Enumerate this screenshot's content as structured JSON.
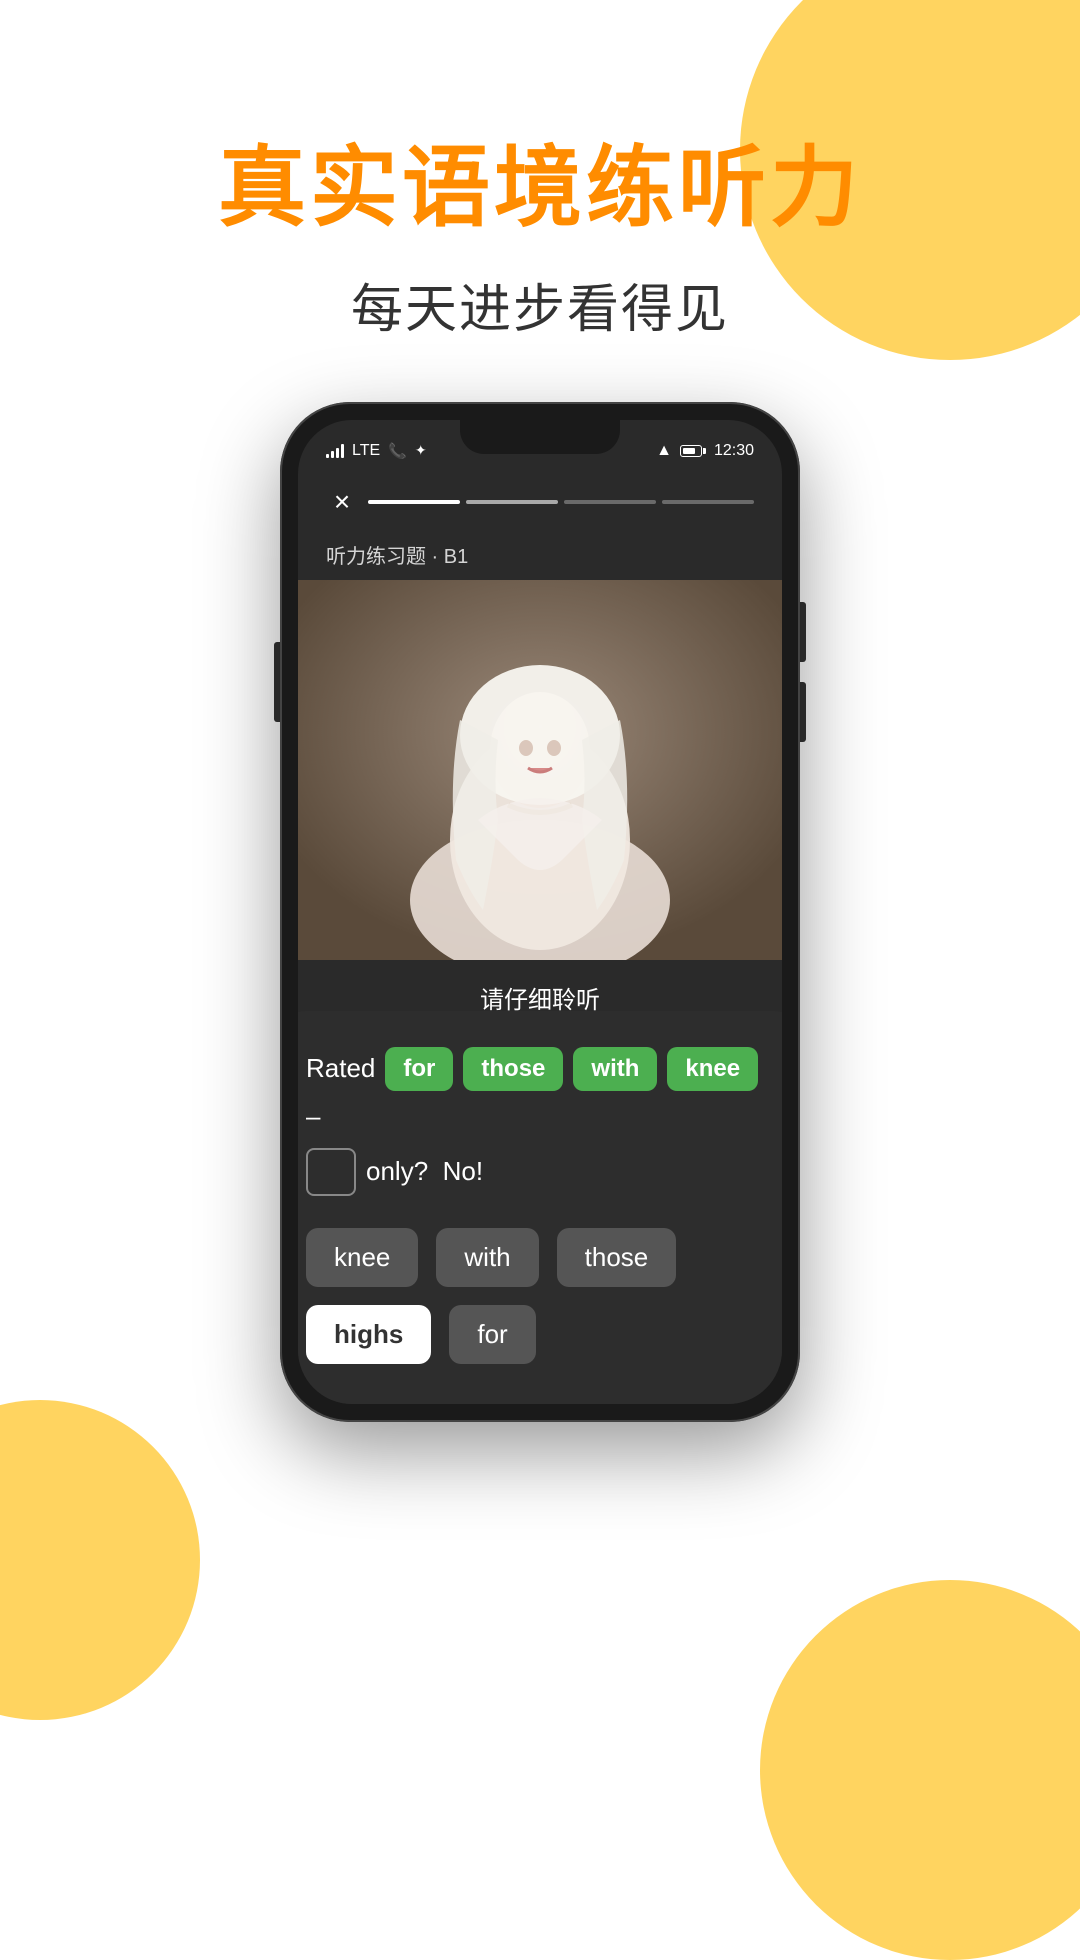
{
  "page": {
    "background": "#ffffff"
  },
  "header": {
    "main_title": "真实语境练听力",
    "sub_title": "每天进步看得见"
  },
  "phone": {
    "status_bar": {
      "time": "12:30",
      "lte_label": "LTE"
    },
    "exercise_label": "听力练习题 · B1",
    "listen_prompt": "请仔细聆听",
    "progress_segments": [
      "done",
      "active",
      "inactive",
      "inactive"
    ],
    "sentence": {
      "line1_words": [
        {
          "text": "Rated",
          "type": "static"
        },
        {
          "text": "for",
          "type": "green-chip"
        },
        {
          "text": "those",
          "type": "green-chip"
        },
        {
          "text": "with",
          "type": "green-chip"
        },
        {
          "text": "knee",
          "type": "green-chip"
        },
        {
          "text": "–",
          "type": "dash"
        }
      ],
      "line2_words": [
        {
          "text": "",
          "type": "blank"
        },
        {
          "text": "only?",
          "type": "static"
        },
        {
          "text": "No!",
          "type": "static"
        }
      ]
    },
    "word_choices": [
      {
        "text": "knee",
        "state": "default"
      },
      {
        "text": "with",
        "state": "default"
      },
      {
        "text": "those",
        "state": "default"
      },
      {
        "text": "highs",
        "state": "selected"
      },
      {
        "text": "for",
        "state": "default"
      }
    ],
    "close_button": "×"
  }
}
